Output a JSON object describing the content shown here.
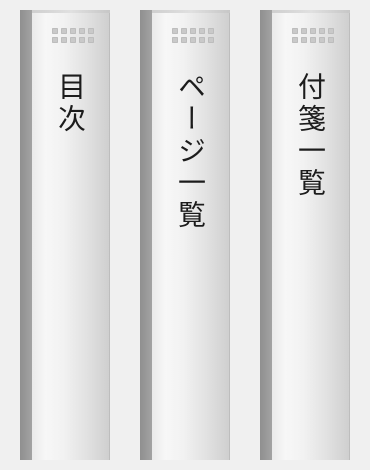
{
  "spines": [
    {
      "label": "目次",
      "icon": "grip-dots-icon"
    },
    {
      "label": "ページ一覧",
      "icon": "grip-dots-icon"
    },
    {
      "label": "付箋一覧",
      "icon": "grip-dots-icon"
    }
  ]
}
